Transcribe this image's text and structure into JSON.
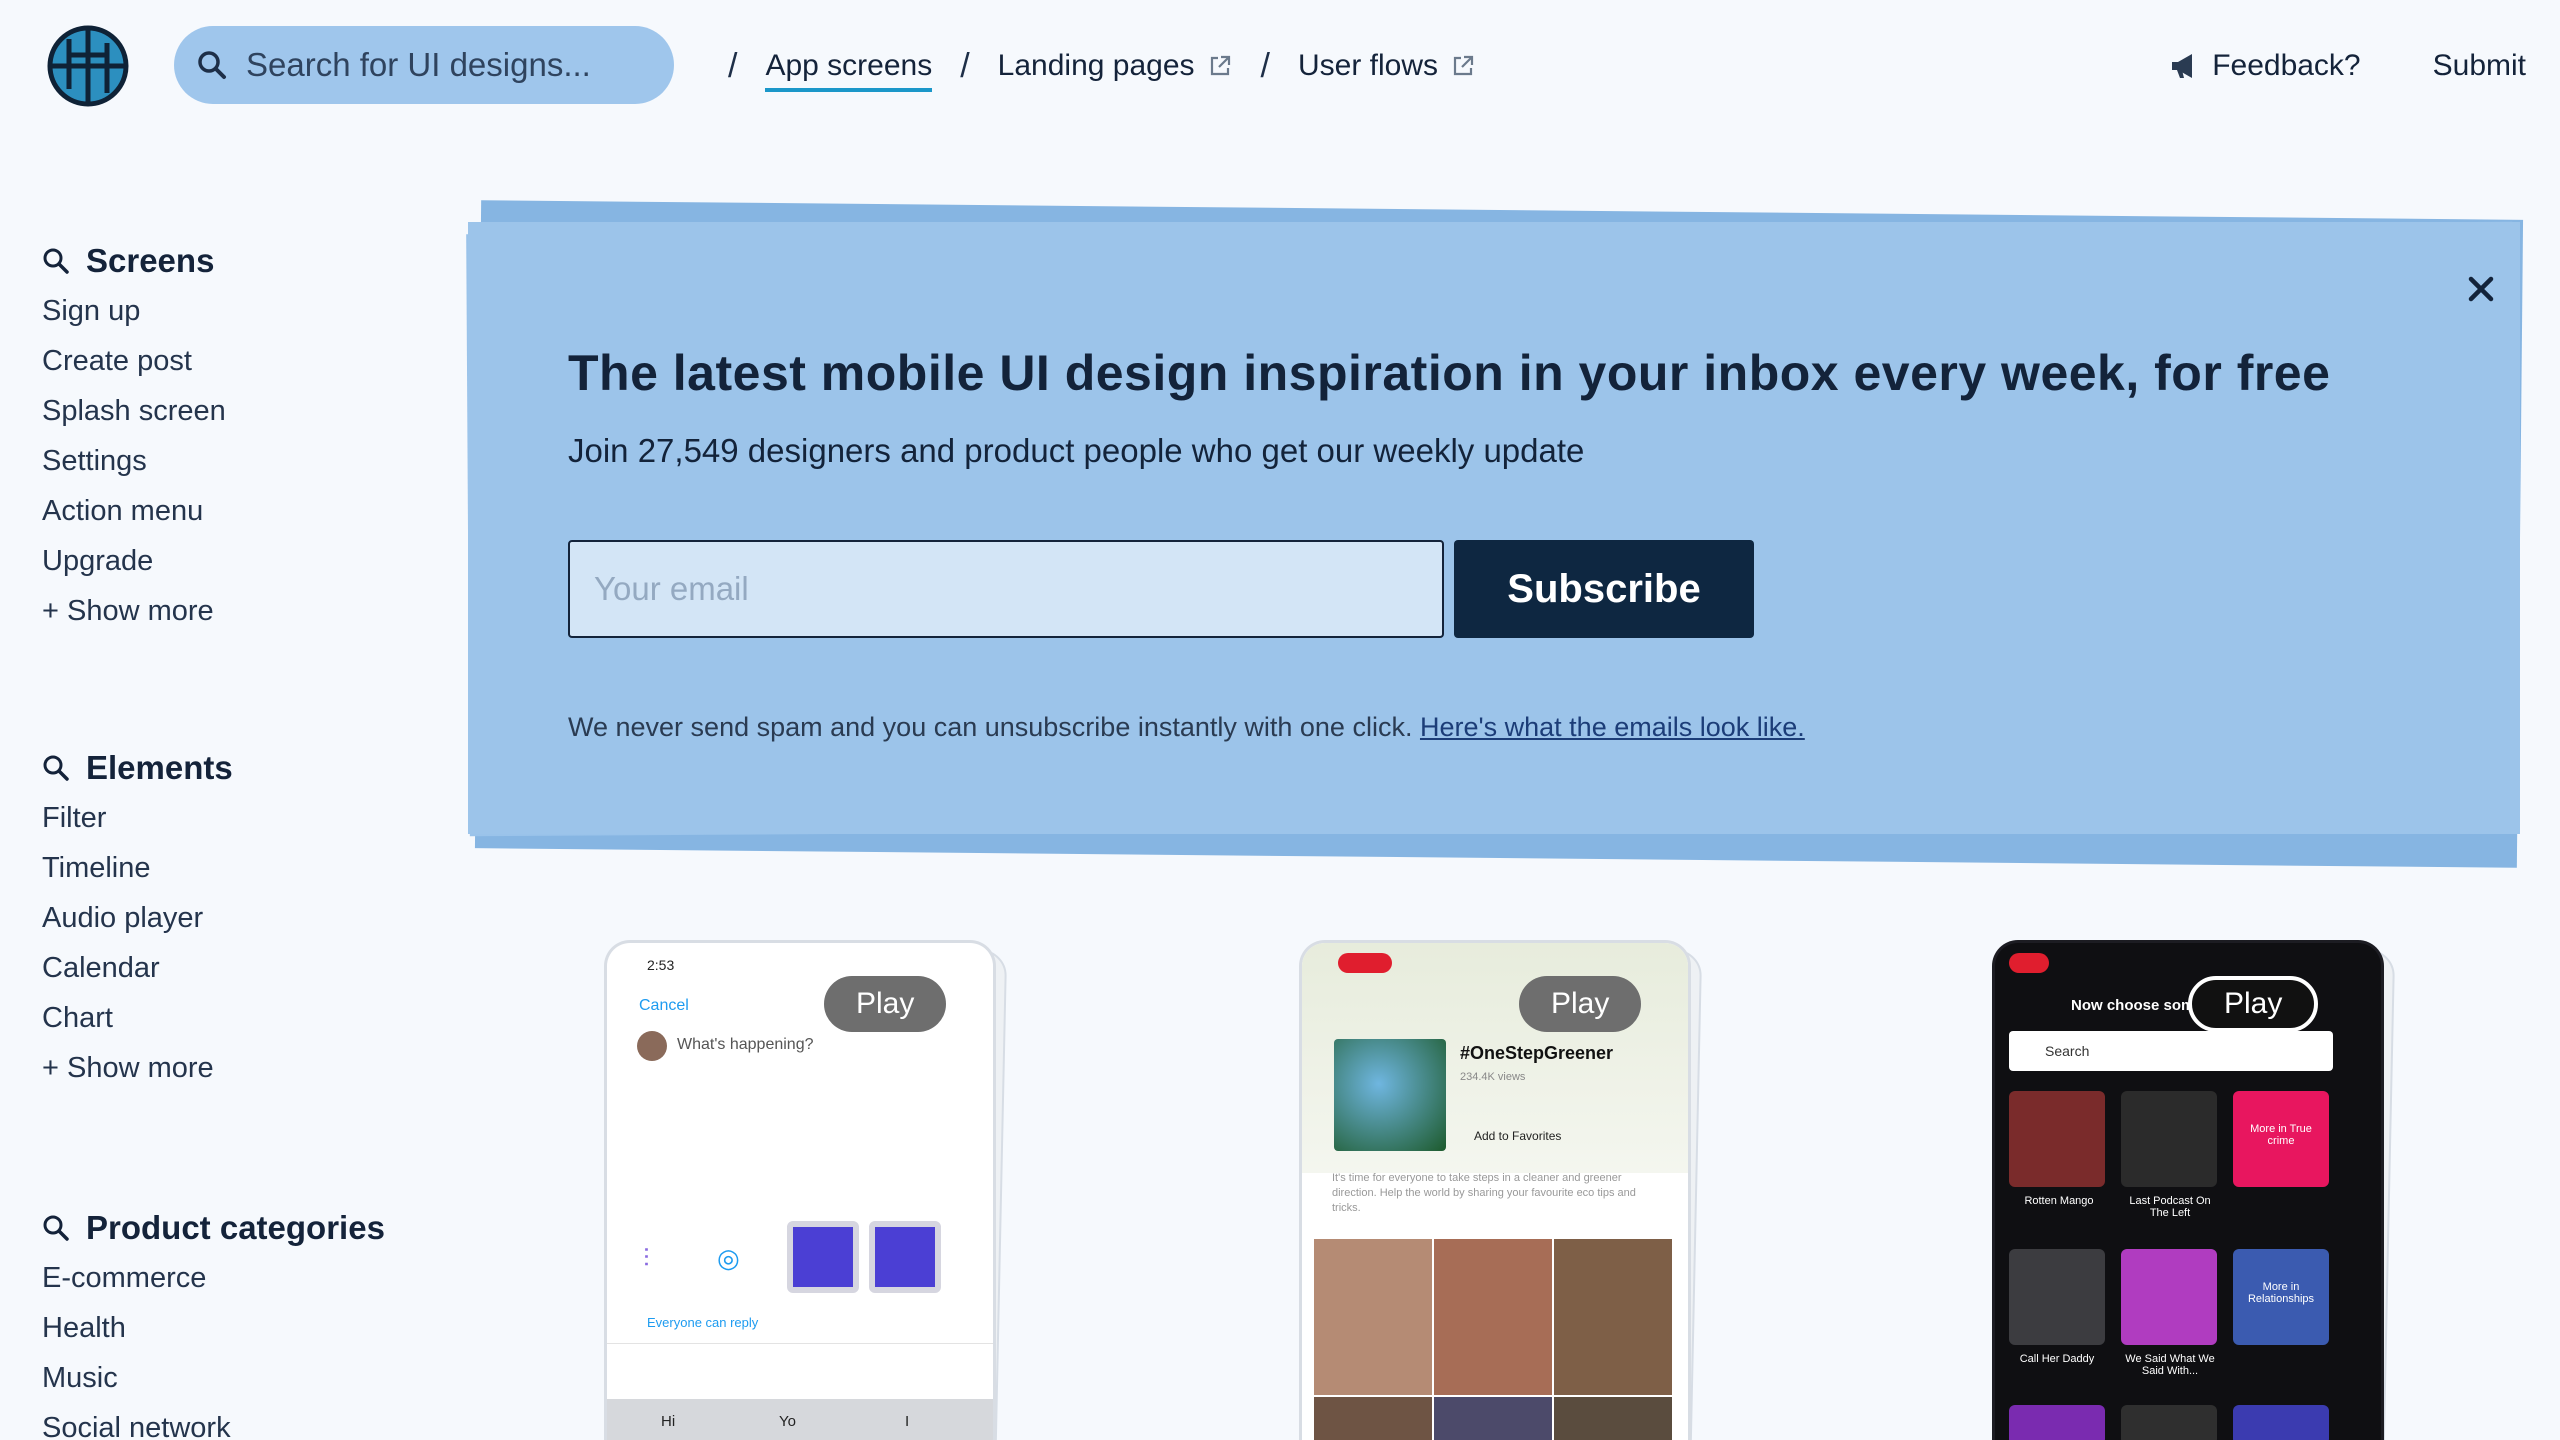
{
  "header": {
    "search_placeholder": "Search for UI designs...",
    "nav": [
      {
        "label": "App screens",
        "active": true,
        "external": false
      },
      {
        "label": "Landing pages",
        "active": false,
        "external": true
      },
      {
        "label": "User flows",
        "active": false,
        "external": true
      }
    ],
    "feedback": "Feedback?",
    "submit": "Submit"
  },
  "sidebar": {
    "screens": {
      "title": "Screens",
      "items": [
        "Sign up",
        "Create post",
        "Splash screen",
        "Settings",
        "Action menu",
        "Upgrade",
        "+ Show more"
      ]
    },
    "elements": {
      "title": "Elements",
      "items": [
        "Filter",
        "Timeline",
        "Audio player",
        "Calendar",
        "Chart",
        "+ Show more"
      ]
    },
    "categories": {
      "title": "Product categories",
      "items": [
        "E-commerce",
        "Health",
        "Music",
        "Social network"
      ]
    }
  },
  "banner": {
    "title": "The latest mobile UI design inspiration in your inbox every week, for free",
    "subtitle": "Join 27,549 designers and product people who get our weekly update",
    "email_placeholder": "Your email",
    "subscribe": "Subscribe",
    "spam_text": "We never send spam and you can unsubscribe instantly with one click.",
    "spam_link": "Here's what the emails look like."
  },
  "cards": [
    {
      "play": "Play",
      "time": "2:53",
      "cancel": "Cancel",
      "prompt": "What's happening?",
      "reply": "Everyone can reply",
      "keys": [
        "Hi",
        "Yo",
        "I"
      ]
    },
    {
      "play": "Play",
      "hashtag": "#OneStepGreener",
      "views": "234.4K views",
      "fav": "Add to Favorites",
      "desc": "It's time for everyone to take steps in a cleaner and greener direction. Help the world by sharing your favourite eco tips and tricks."
    },
    {
      "play": "Play",
      "heading": "Now choose some po",
      "search": "Search",
      "tiles": [
        "Rotten Mango",
        "Last Podcast On The Left",
        "More in True crime",
        "Call Her Daddy",
        "We Said What We Said With...",
        "More in Relationships"
      ]
    }
  ],
  "colors": {
    "accent": "#1b97c9",
    "banner": "#9cc4ea",
    "subscribe_bg": "#0e2741",
    "search_bg": "#9fc6ec",
    "page_bg": "#f6f9fd"
  }
}
